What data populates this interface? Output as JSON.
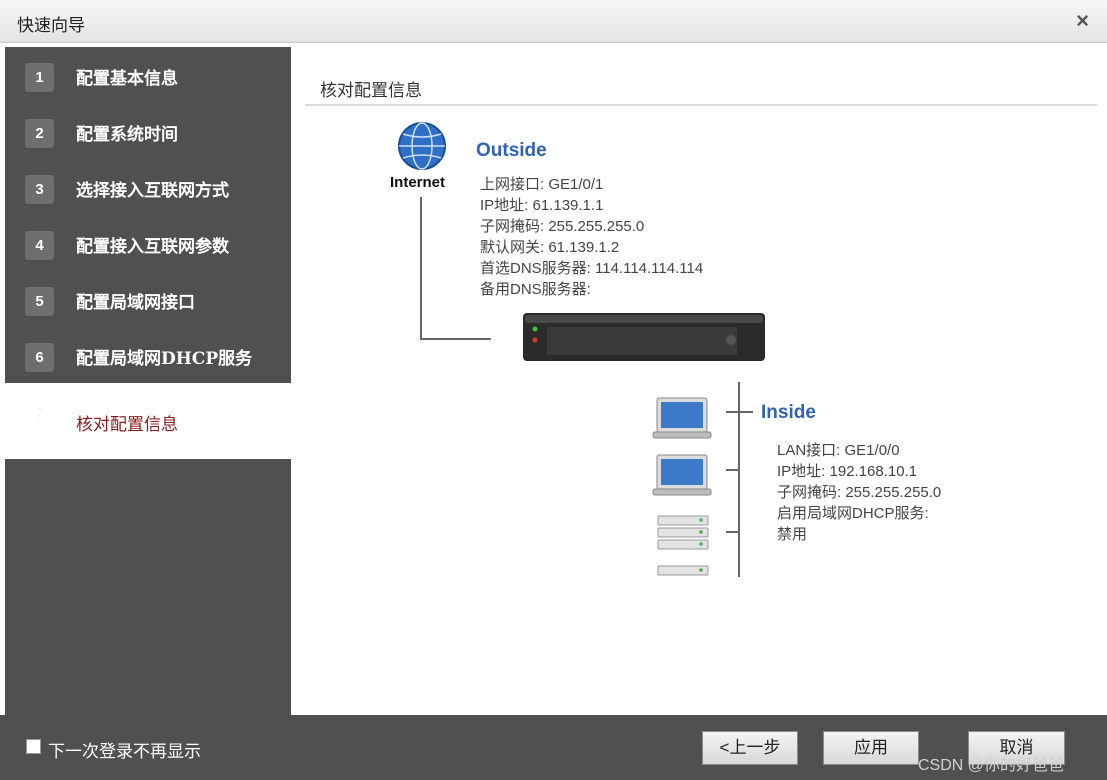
{
  "window": {
    "title": "快速向导",
    "close_glyph": "×"
  },
  "sidebar": {
    "steps": [
      {
        "num": "1",
        "label": "配置基本信息"
      },
      {
        "num": "2",
        "label": "配置系统时间"
      },
      {
        "num": "3",
        "label": "选择接入互联网方式"
      },
      {
        "num": "4",
        "label": "配置接入互联网参数"
      },
      {
        "num": "5",
        "label": "配置局域网接口"
      },
      {
        "num": "6",
        "label": "配置局域网DHCP服务"
      },
      {
        "num": "7",
        "label": "核对配置信息"
      }
    ],
    "active_step": 7
  },
  "main": {
    "title": "核对配置信息",
    "internet_label": "Internet",
    "outside": {
      "heading": "Outside",
      "lines": [
        "上网接口: GE1/0/1",
        "IP地址: 61.139.1.1",
        "子网掩码: 255.255.255.0",
        "默认网关: 61.139.1.2",
        "首选DNS服务器: 114.114.114.114",
        "备用DNS服务器:"
      ]
    },
    "inside": {
      "heading": "Inside",
      "lines": [
        "LAN接口: GE1/0/0",
        "IP地址: 192.168.10.1",
        "子网掩码: 255.255.255.0",
        "启用局域网DHCP服务:",
        "禁用"
      ]
    }
  },
  "footer": {
    "checkbox_label": "下一次登录不再显示",
    "checkbox_checked": false,
    "prev_label": "<上一步",
    "apply_label": "应用",
    "cancel_label": "取消",
    "watermark": "CSDN @你的好爸爸"
  },
  "colors": {
    "sidebar": "#505050",
    "accent_blue": "#2f63b8",
    "active_step": "#8b1c1c"
  },
  "icons": [
    "globe-icon",
    "firewall-device-icon",
    "laptop-icon",
    "server-icon",
    "close-icon",
    "checkbox"
  ]
}
